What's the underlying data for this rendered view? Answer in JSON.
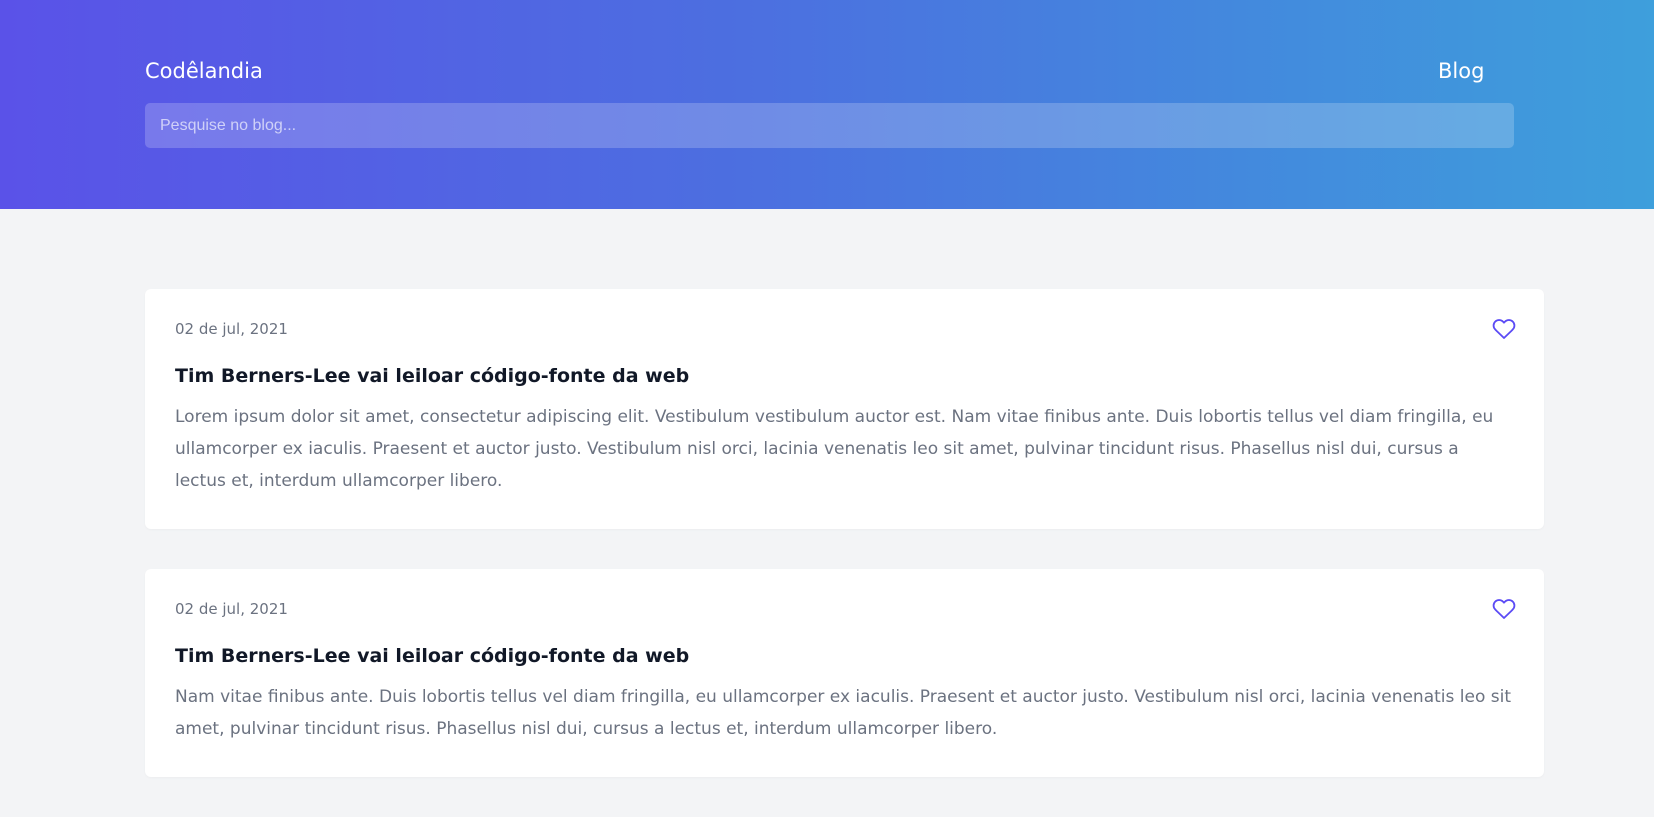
{
  "header": {
    "brand": "Codêlandia",
    "nav_blog": "Blog",
    "search_placeholder": "Pesquise no blog..."
  },
  "colors": {
    "accent": "#5b4bf5",
    "gradient_start": "#5a52e8",
    "gradient_end": "#3e9fdc"
  },
  "posts": [
    {
      "date": "02 de jul, 2021",
      "title": "Tim Berners-Lee vai leiloar código-fonte da web",
      "excerpt": "Lorem ipsum dolor sit amet, consectetur adipiscing elit. Vestibulum vestibulum auctor est. Nam vitae finibus ante. Duis lobortis tellus vel diam fringilla, eu ullamcorper ex iaculis. Praesent et auctor justo. Vestibulum nisl orci, lacinia venenatis leo sit amet, pulvinar tincidunt risus. Phasellus nisl dui, cursus a lectus et, interdum ullamcorper libero.",
      "icon": "heart-outline-icon"
    },
    {
      "date": "02 de jul, 2021",
      "title": "Tim Berners-Lee vai leiloar código-fonte da web",
      "excerpt": "Nam vitae finibus ante. Duis lobortis tellus vel diam fringilla, eu ullamcorper ex iaculis. Praesent et auctor justo. Vestibulum nisl orci, lacinia venenatis leo sit amet, pulvinar tincidunt risus. Phasellus nisl dui, cursus a lectus et, interdum ullamcorper libero.",
      "icon": "heart-outline-icon"
    }
  ]
}
